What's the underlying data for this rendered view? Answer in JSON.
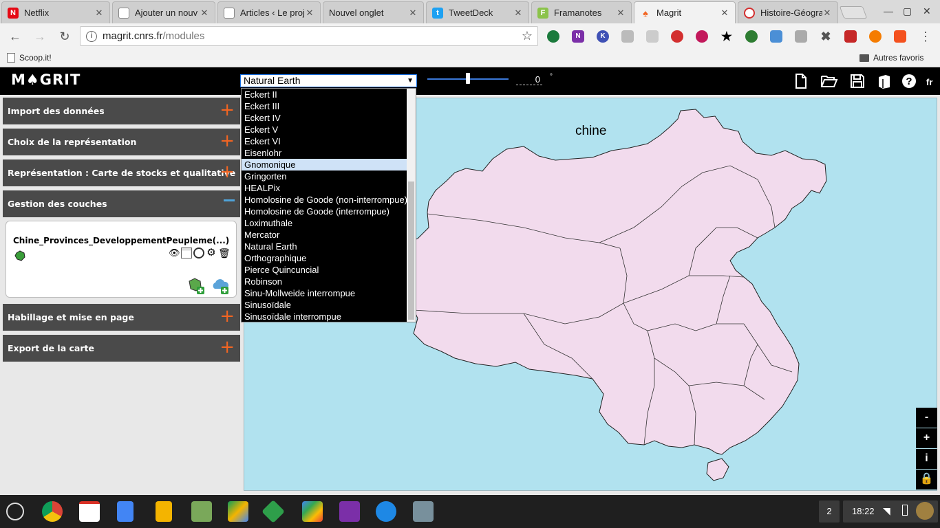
{
  "browser": {
    "tabs": [
      {
        "title": "Netflix",
        "icon": "netflix-icon",
        "color": "#e50914",
        "glyph": "N"
      },
      {
        "title": "Ajouter un nouv",
        "icon": "page-icon",
        "color": "#ffffff",
        "glyph": ""
      },
      {
        "title": "Articles ‹ Le proj",
        "icon": "page-icon",
        "color": "#ffffff",
        "glyph": ""
      },
      {
        "title": "Nouvel onglet",
        "icon": "none",
        "color": "#cfcfcf",
        "glyph": ""
      },
      {
        "title": "TweetDeck",
        "icon": "twitter-icon",
        "color": "#1da1f2",
        "glyph": "t"
      },
      {
        "title": "Framanotes",
        "icon": "framanotes-icon",
        "color": "#8bc34a",
        "glyph": "F"
      },
      {
        "title": "Magrit",
        "icon": "magrit-icon",
        "color": "#f26522",
        "glyph": "♠"
      },
      {
        "title": "Histoire-Géogra",
        "icon": "hg-icon",
        "color": "#d32f2f",
        "glyph": "G"
      }
    ],
    "active_tab": 6,
    "url_host": "magrit.cnrs.fr",
    "url_path": "/modules",
    "bookmarks": [
      {
        "label": "Scoop.it!"
      },
      {
        "label": "Autres favoris"
      }
    ]
  },
  "app": {
    "logo": "M♠GRIT",
    "projection": {
      "selected": "Natural Earth",
      "options": [
        "Eckert II",
        "Eckert III",
        "Eckert IV",
        "Eckert V",
        "Eckert VI",
        "Eisenlohr",
        "Gnomonique",
        "Gringorten",
        "HEALPix",
        "Homolosine de Goode (non-interrompue)",
        "Homolosine de Goode (interrompue)",
        "Loximuthale",
        "Mercator",
        "Natural Earth",
        "Orthographique",
        "Pierce Quincuncial",
        "Robinson",
        "Sinu-Mollweide interrompue",
        "Sinusoïdale",
        "Sinusoïdale interrompue"
      ],
      "highlighted": "Gnomonique"
    },
    "rotation": {
      "value": "0",
      "unit": "°"
    },
    "lang": "fr",
    "sections": [
      {
        "label": "Import des données",
        "expanded": false
      },
      {
        "label": "Choix de la représentation",
        "expanded": false
      },
      {
        "label": "Représentation : Carte de stocks et qualitative",
        "expanded": false
      },
      {
        "label": "Gestion des couches",
        "expanded": true
      },
      {
        "label": "Habillage et mise en page",
        "expanded": false
      },
      {
        "label": "Export de la carte",
        "expanded": false
      }
    ],
    "layer": {
      "name": "Chine_Provinces_DeveloppementPeupleme(...)"
    },
    "map": {
      "title": "chine",
      "sea_color": "#b1e2ef",
      "land_color": "#f2dbed"
    },
    "zoom_buttons": [
      "-",
      "+",
      "i"
    ]
  },
  "os": {
    "notification_count": "2",
    "time": "18:22"
  }
}
